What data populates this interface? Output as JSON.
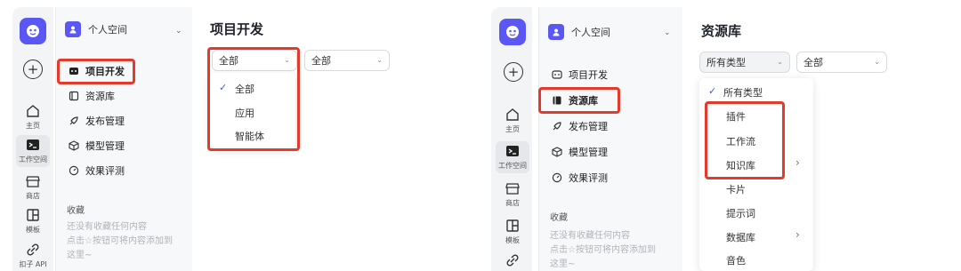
{
  "left": {
    "space_name": "个人空间",
    "rail": [
      {
        "label": "主页"
      },
      {
        "label": "工作空间"
      },
      {
        "label": "商店"
      },
      {
        "label": "模板"
      },
      {
        "label": "扣子 API"
      }
    ],
    "nav": [
      {
        "label": "项目开发"
      },
      {
        "label": "资源库"
      },
      {
        "label": "发布管理"
      },
      {
        "label": "模型管理"
      },
      {
        "label": "效果评测"
      }
    ],
    "fav_title": "收藏",
    "fav_line1": "还没有收藏任何内容",
    "fav_line2": "点击☆按钮可将内容添加到",
    "fav_line3": "这里~",
    "page_title": "项目开发",
    "select1_value": "全部",
    "select2_value": "全部",
    "dropdown_options": [
      "全部",
      "应用",
      "智能体"
    ]
  },
  "right": {
    "space_name": "个人空间",
    "rail": [
      {
        "label": "主页"
      },
      {
        "label": "工作空间"
      },
      {
        "label": "商店"
      },
      {
        "label": "模板"
      }
    ],
    "nav": [
      {
        "label": "项目开发"
      },
      {
        "label": "资源库"
      },
      {
        "label": "发布管理"
      },
      {
        "label": "模型管理"
      },
      {
        "label": "效果评测"
      }
    ],
    "fav_title": "收藏",
    "fav_line1": "还没有收藏任何内容",
    "fav_line2": "点击☆按钮可将内容添加到",
    "fav_line3": "这里~",
    "page_title": "资源库",
    "select1_value": "所有类型",
    "select2_value": "全部",
    "dropdown_options": [
      "所有类型",
      "插件",
      "工作流",
      "知识库",
      "卡片",
      "提示词",
      "数据库",
      "音色"
    ]
  },
  "colors": {
    "accent": "#5b57f5",
    "highlight": "#e33a2b",
    "check": "#3b5bdb"
  }
}
